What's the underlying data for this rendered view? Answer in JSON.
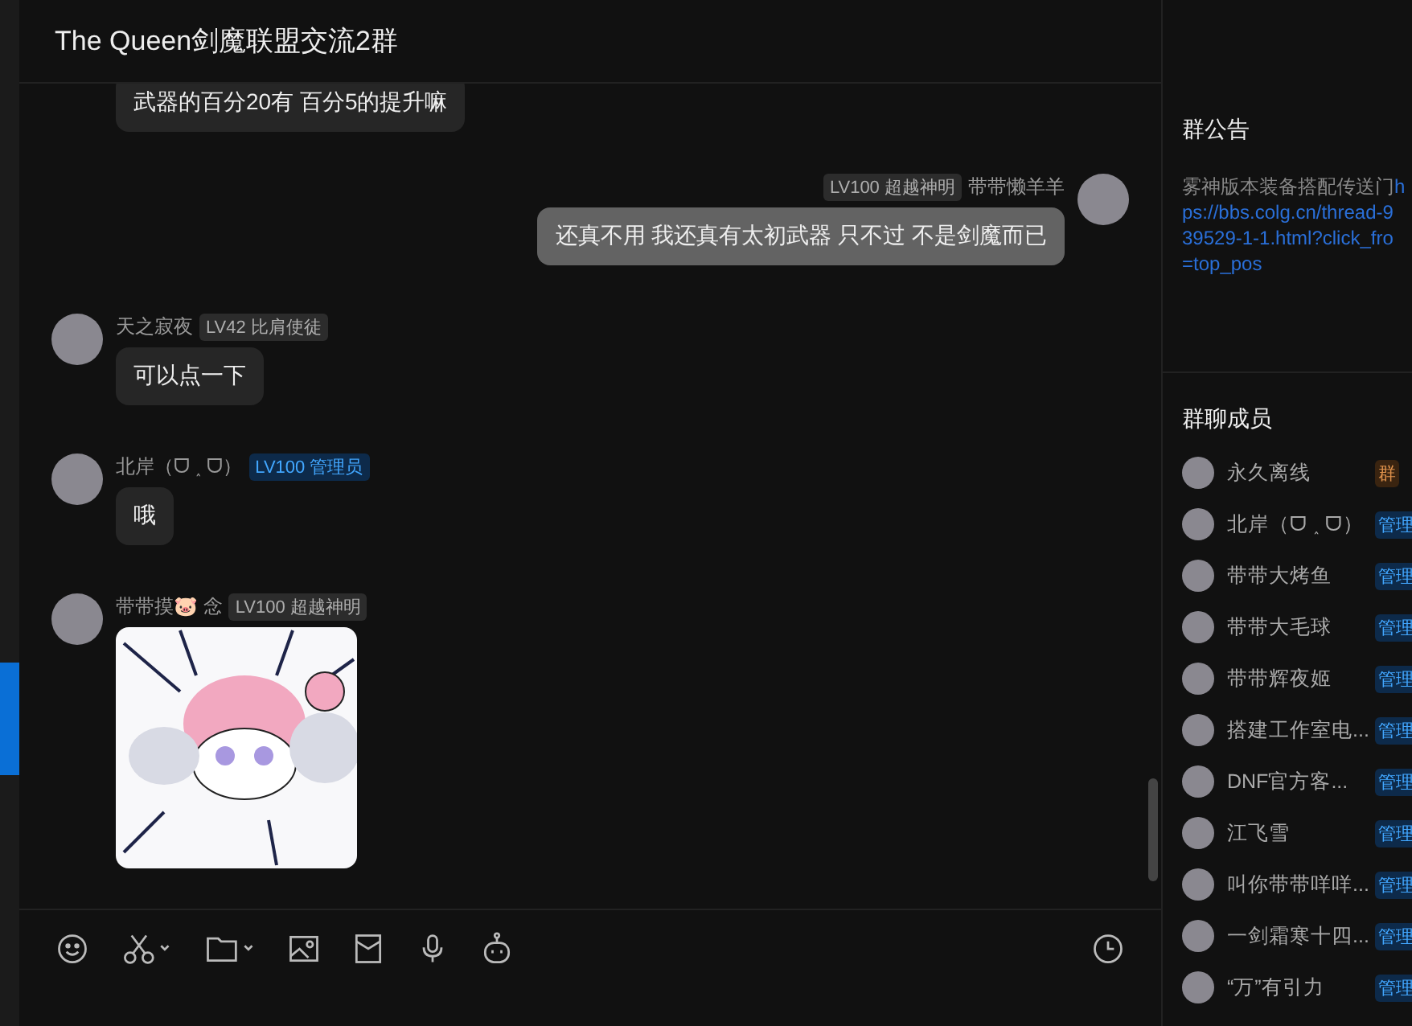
{
  "window": {
    "title": "The Queen剑魔联盟交流2群"
  },
  "messages": [
    {
      "kind": "incoming_text",
      "text": "武器的百分20有  百分5的提升嘛"
    },
    {
      "kind": "outgoing_text",
      "sender": "带带懒羊羊",
      "badge": "LV100 超越神明",
      "color": "#2c2c2c",
      "text": "还真不用  我还真有太初武器 只不过 不是剑魔而已"
    },
    {
      "kind": "incoming_text",
      "sender": "天之寂夜",
      "badge": "LV42 比肩使徒",
      "color": "#2c2c2c",
      "text": "可以点一下"
    },
    {
      "kind": "incoming_text",
      "sender": "北岸（ᗜ ˰ ᗜ）",
      "badge": "LV100 管理员",
      "color": "#0d2a4a",
      "text": "哦"
    },
    {
      "kind": "incoming_image",
      "sender": "带带摸🐷 念",
      "badge": "LV100 超越神明",
      "color": "#2c2c2c"
    }
  ],
  "notice": {
    "title": "群公告",
    "text": "雾神版本装备搭配传送门",
    "link_lines": [
      "h",
      "ps://bbs.colg.cn/thread-9",
      "39529-1-1.html?click_fro",
      "=top_pos"
    ]
  },
  "members": {
    "title": "群聊成员",
    "items": [
      {
        "name": "永久离线",
        "role": "群",
        "color": "#3a2410"
      },
      {
        "name": "北岸（ᗜ ˰ ᗜ）",
        "role": "管理",
        "color": "#0d2a4a"
      },
      {
        "name": "带带大烤鱼",
        "role": "管理",
        "color": "#0d2a4a"
      },
      {
        "name": "带带大毛球",
        "role": "管理",
        "color": "#0d2a4a"
      },
      {
        "name": "带带辉夜姬",
        "role": "管理",
        "color": "#0d2a4a"
      },
      {
        "name": "搭建工作室电...",
        "role": "管理",
        "color": "#0d2a4a"
      },
      {
        "name": "DNF官方客...",
        "role": "管理",
        "color": "#0d2a4a"
      },
      {
        "name": "江飞雪",
        "role": "管理",
        "color": "#0d2a4a"
      },
      {
        "name": "叫你带带咩咩...",
        "role": "管理",
        "color": "#0d2a4a"
      },
      {
        "name": "一剑霜寒十四...",
        "role": "管理",
        "color": "#0d2a4a"
      },
      {
        "name": "“万”有引力",
        "role": "管理",
        "color": "#0d2a4a"
      }
    ]
  }
}
